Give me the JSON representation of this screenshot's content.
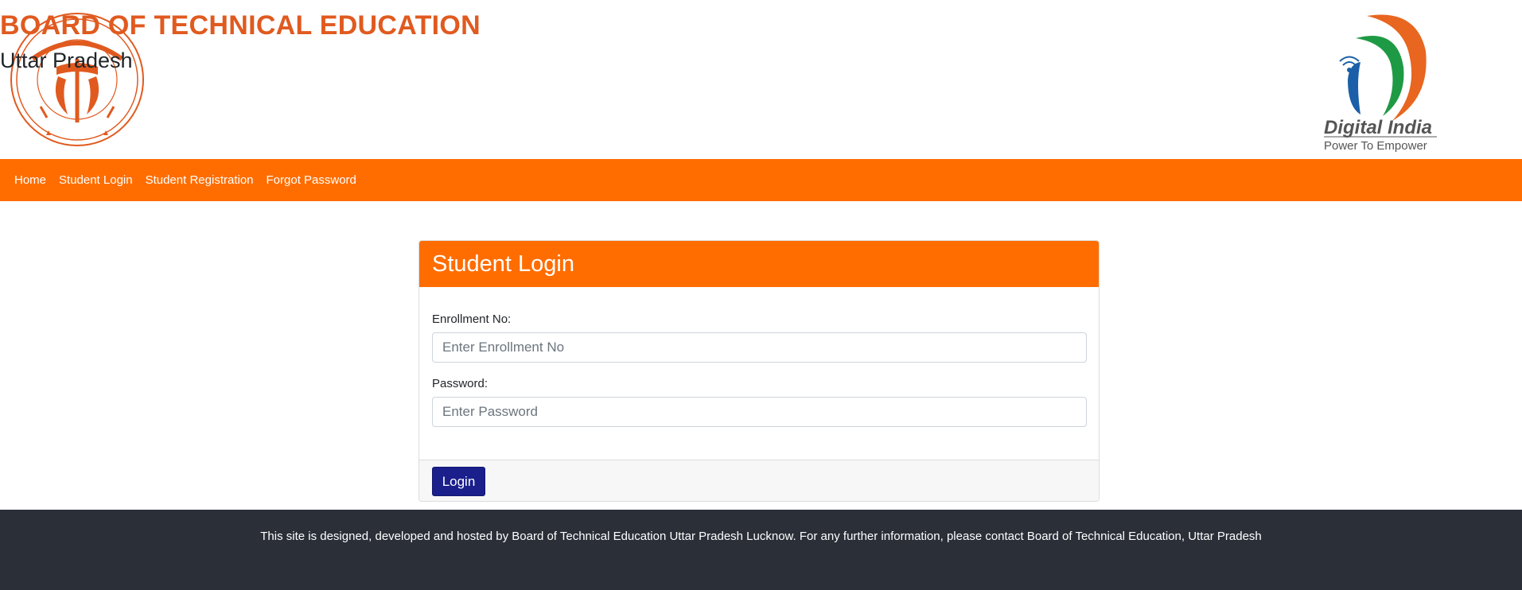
{
  "header": {
    "title": "BOARD OF TECHNICAL EDUCATION",
    "subtitle": "Uttar Pradesh",
    "left_logo": {
      "icon": "up-government-emblem",
      "color": "#e05a1f"
    },
    "right_logo": {
      "icon": "digital-india-logo",
      "title": "Digital India",
      "tagline": "Power To Empower"
    }
  },
  "nav": {
    "items": [
      {
        "label": "Home"
      },
      {
        "label": "Student Login"
      },
      {
        "label": "Student Registration"
      },
      {
        "label": "Forgot Password"
      }
    ]
  },
  "login_card": {
    "title": "Student Login",
    "enrollment": {
      "label": "Enrollment No:",
      "placeholder": "Enter Enrollment No",
      "value": ""
    },
    "password": {
      "label": "Password:",
      "placeholder": "Enter Password",
      "value": ""
    },
    "login_button": "Login"
  },
  "footer": {
    "text": "This site is designed, developed and hosted by Board of Technical Education Uttar Pradesh Lucknow. For any further information, please contact Board of Technical Education, Uttar Pradesh"
  },
  "colors": {
    "accent": "#ff6d00",
    "title": "#e05a1f",
    "button": "#1a1f8c",
    "footer_bg": "#2a2f38"
  }
}
